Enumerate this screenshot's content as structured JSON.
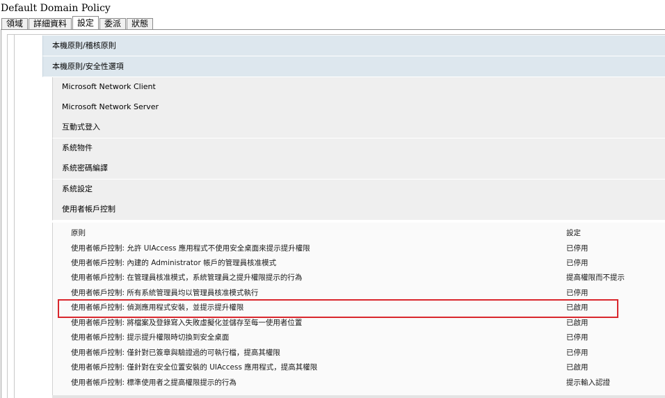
{
  "window_title": "Default Domain Policy",
  "tabs": [
    {
      "label": "領域"
    },
    {
      "label": "詳細資料"
    },
    {
      "label": "設定"
    },
    {
      "label": "委派"
    },
    {
      "label": "狀態"
    }
  ],
  "active_tab": "設定",
  "sections": {
    "audit_policy": "本機原則/稽核原則",
    "security_options": "本機原則/安全性選項"
  },
  "subsections": [
    "Microsoft Network Client",
    "Microsoft Network Server",
    "互動式登入",
    "系統物件",
    "系統密碼編譯",
    "系統設定",
    "使用者帳戶控制"
  ],
  "table": {
    "headers": {
      "policy": "原則",
      "setting": "設定"
    },
    "rows": [
      {
        "policy": "使用者帳戶控制: 允許 UIAccess 應用程式不使用安全桌面來提示提升權限",
        "setting": "已停用"
      },
      {
        "policy": "使用者帳戶控制: 內建的 Administrator 帳戶的管理員核准模式",
        "setting": "已停用"
      },
      {
        "policy": "使用者帳戶控制: 在管理員核准模式，系統管理員之提升權限提示的行為",
        "setting": "提高權限而不提示"
      },
      {
        "policy": "使用者帳戶控制: 所有系統管理員均以管理員核准模式執行",
        "setting": "已停用"
      },
      {
        "policy": "使用者帳戶控制: 偵測應用程式安裝，並提示提升權限",
        "setting": "已啟用"
      },
      {
        "policy": "使用者帳戶控制: 將檔案及登錄寫入失敗虛擬化並儲存至每一使用者位置",
        "setting": "已啟用"
      },
      {
        "policy": "使用者帳戶控制: 提示提升權限時切換到安全桌面",
        "setting": "已停用"
      },
      {
        "policy": "使用者帳戶控制: 僅針對已簽章與驗證過的可執行檔，提高其權限",
        "setting": "已停用"
      },
      {
        "policy": "使用者帳戶控制: 僅針對在安全位置安裝的 UIAccess 應用程式，提高其權限",
        "setting": "已啟用"
      },
      {
        "policy": "使用者帳戶控制: 標準使用者之提高權限提示的行為",
        "setting": "提示輸入認證"
      }
    ]
  },
  "highlight_color": "#d9262c",
  "highlighted_row_policy": "使用者帳戶控制: 偵測應用程式安裝，並提示提升權限"
}
